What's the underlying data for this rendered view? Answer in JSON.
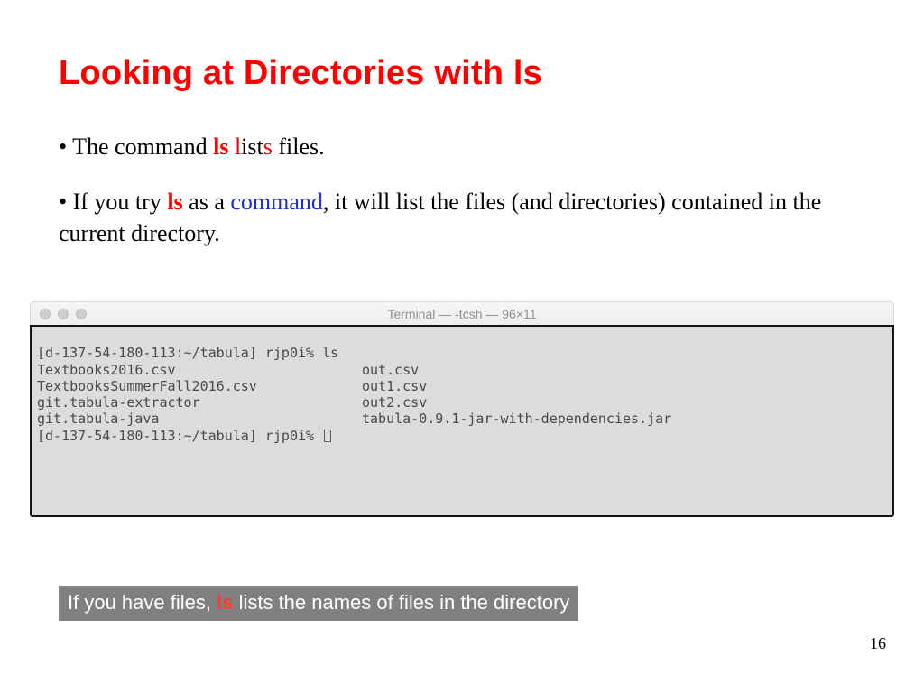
{
  "title": "Looking at Directories with ls",
  "bullet1": {
    "pre": "• The command ",
    "ls": "ls",
    "mid1": " ",
    "l": "l",
    "ist": "ist",
    "s": "s",
    "post": " files."
  },
  "bullet2": {
    "pre": "• If you try ",
    "ls": "ls",
    "mid1": " as a ",
    "command": "command",
    "post": ", it will list the files (and directories) contained in the current directory."
  },
  "terminal": {
    "title": "Terminal — -tcsh — 96×11",
    "prompt1": "[d-137-54-180-113:~/tabula] rjp0i% ls",
    "col1": [
      "Textbooks2016.csv",
      "TextbooksSummerFall2016.csv",
      "git.tabula-extractor",
      "git.tabula-java"
    ],
    "col2": [
      "out.csv",
      "out1.csv",
      "out2.csv",
      "tabula-0.9.1-jar-with-dependencies.jar"
    ],
    "prompt2": "[d-137-54-180-113:~/tabula] rjp0i% "
  },
  "footer": {
    "pre": "If you have files, ",
    "ls": "ls",
    "post": " lists the names of files in the directory"
  },
  "page": "16"
}
